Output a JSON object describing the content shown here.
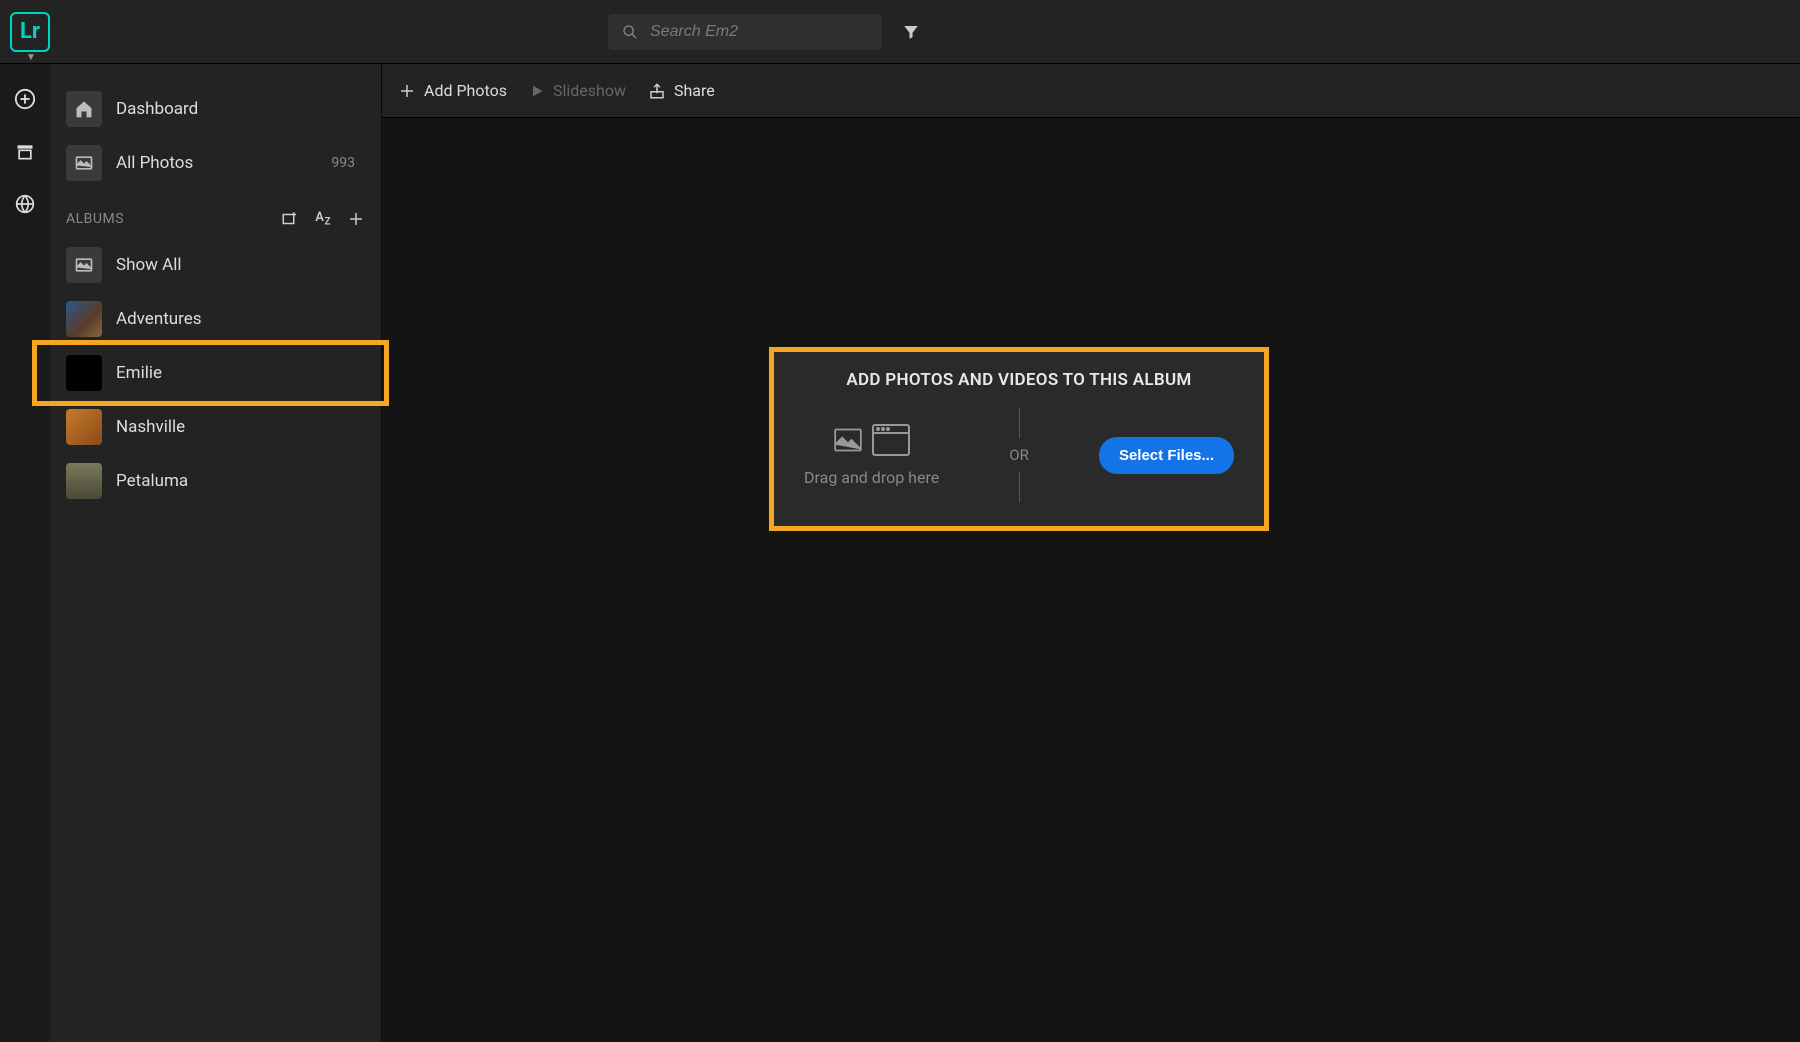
{
  "app": {
    "logo_text": "Lr"
  },
  "search": {
    "placeholder": "Search Em2"
  },
  "sidebar": {
    "dashboard_label": "Dashboard",
    "all_photos_label": "All Photos",
    "all_photos_count": "993",
    "albums_header": "ALBUMS",
    "show_all_label": "Show All",
    "albums": [
      {
        "label": "Adventures"
      },
      {
        "label": "Emilie"
      },
      {
        "label": "Nashville"
      },
      {
        "label": "Petaluma"
      }
    ]
  },
  "toolbar": {
    "add_photos_label": "Add Photos",
    "slideshow_label": "Slideshow",
    "share_label": "Share"
  },
  "drop_panel": {
    "title": "ADD PHOTOS AND VIDEOS TO THIS ALBUM",
    "drag_text": "Drag and drop here",
    "or_text": "OR",
    "select_button": "Select Files..."
  }
}
